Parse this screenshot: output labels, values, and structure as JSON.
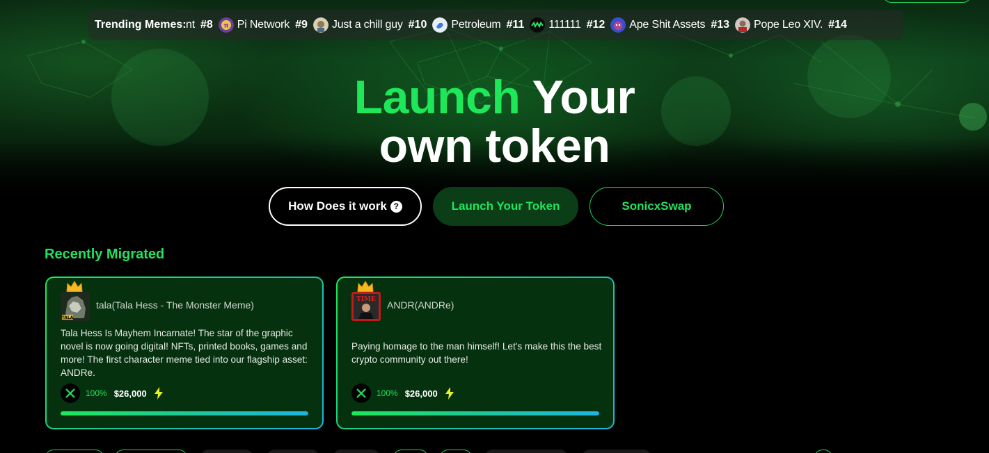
{
  "ticker": {
    "label": "Trending Memes:",
    "items": [
      {
        "rank": "",
        "name": "nt",
        "avatar_color": "#000000"
      },
      {
        "rank": "#8",
        "name": "Pi Network",
        "avatar_color": "#6b3fa0"
      },
      {
        "rank": "#9",
        "name": "Just a chill guy",
        "avatar_color": "#b7a98a"
      },
      {
        "rank": "#10",
        "name": "Petroleum",
        "avatar_color": "#e8eef6"
      },
      {
        "rank": "#11",
        "name": "111111",
        "avatar_color": "#0a0a0a"
      },
      {
        "rank": "#12",
        "name": "Ape Shit Assets",
        "avatar_color": "#3a4fd0"
      },
      {
        "rank": "#13",
        "name": "Pope Leo XIV.",
        "avatar_color": "#8a6a5a"
      },
      {
        "rank": "#14",
        "name": "",
        "avatar_color": "#000000"
      }
    ]
  },
  "hero": {
    "title_green": "Launch",
    "title_white_1": "Your",
    "title_white_2": "own token"
  },
  "cta": {
    "how_label": "How Does it work",
    "how_icon": "question-circle-icon",
    "launch_label": "Launch Your Token",
    "swap_label": "SonicxSwap"
  },
  "recently_migrated": {
    "title": "Recently Migrated",
    "cards": [
      {
        "name": "tala(Tala Hess - The Monster Meme)",
        "description": "Tala Hess Is Mayhem Incarnate! The star of the graphic novel is now going digital! NFTs, printed books, games and more! The first character meme tied into our flagship asset: ANDRe.",
        "percent": "100%",
        "market_cap": "$26,000",
        "progress": 1.0,
        "avatar_label": "TALA"
      },
      {
        "name": "ANDR(ANDRe)",
        "description": "Paying homage to the man himself! Let's make this the best crypto community out there!",
        "percent": "100%",
        "market_cap": "$26,000",
        "progress": 1.0,
        "avatar_label": "TIME"
      }
    ]
  },
  "colors": {
    "accent_green": "#22e35f",
    "card_bg": "#06310f",
    "gradient_end": "#1fb4e0"
  }
}
